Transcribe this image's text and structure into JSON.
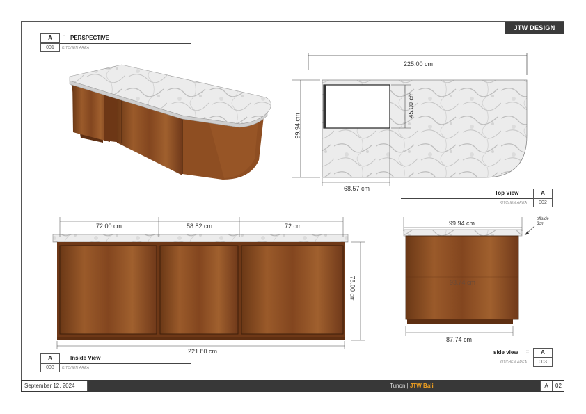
{
  "brand": "JTW DESIGN",
  "footer": {
    "date": "September 12, 2024",
    "project_prefix": "Tunon",
    "project_divider": "|",
    "project_name": "JTW Bali",
    "sheet_letter": "A",
    "sheet_number": "02"
  },
  "views": {
    "perspective": {
      "ref": "A",
      "sep": "::",
      "title": "PERSPECTIVE",
      "number": "001",
      "area": "KITCHEN AREA"
    },
    "top": {
      "ref": "A",
      "sep": "::",
      "title": "Top View",
      "number": "002",
      "area": "KITCHEN AREA"
    },
    "inside": {
      "ref": "A",
      "sep": "::",
      "title": "Inside View",
      "number": "003",
      "area": "KITCHEN AREA"
    },
    "side": {
      "ref": "A",
      "sep": "::",
      "title": "side view",
      "number": "003",
      "area": "KITCHEN AREA"
    }
  },
  "dimensions": {
    "top_width": "225.00 cm",
    "top_depth": "99.94 cm",
    "sink_depth": "45.00 cm",
    "sink_width": "68.57 cm",
    "inside_seg1": "72.00 cm",
    "inside_seg2": "58.82 cm",
    "inside_seg3": "72 cm",
    "inside_height": "75.00 cm",
    "inside_total": "221.80 cm",
    "side_top": "99.94 cm",
    "side_mid": "93.74 cm",
    "side_bottom": "87.74 cm"
  },
  "note": "offside 3cm",
  "colors": {
    "wood": "#8a4a22",
    "wood_dark": "#5e2f12",
    "marble": "#e4e4e4",
    "dark_bar": "#383838",
    "accent": "#f0a020"
  }
}
